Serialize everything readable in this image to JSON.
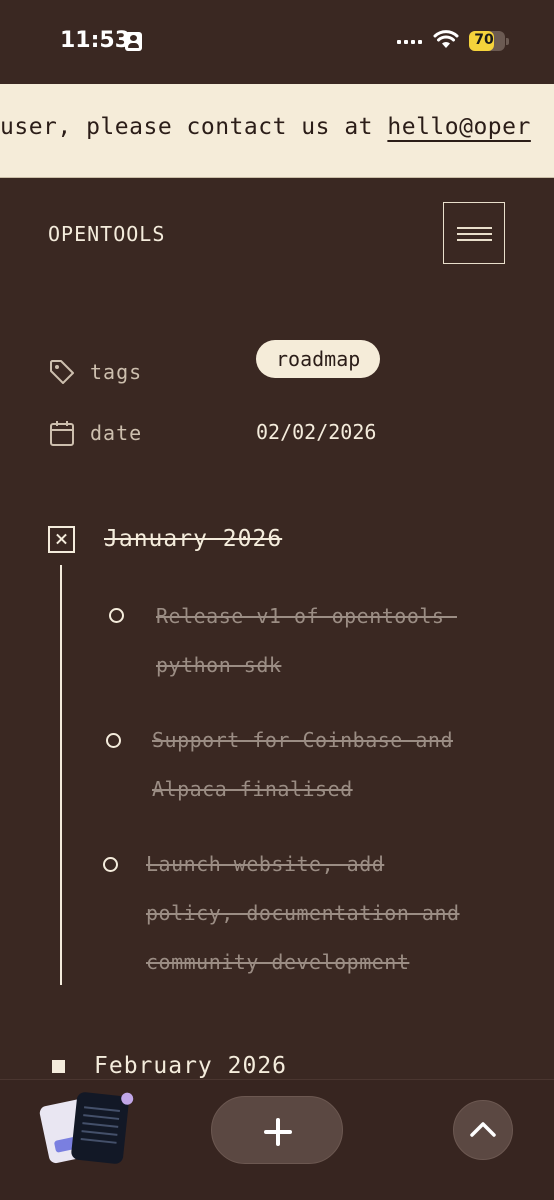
{
  "status_bar": {
    "time": "11:53",
    "battery": "70",
    "battery_level": 0.7,
    "icons": [
      "person-id-icon",
      "signal-dots-icon",
      "wifi-icon",
      "battery-icon"
    ]
  },
  "banner": {
    "text_before": "user, please contact us at ",
    "email": "hello@oper"
  },
  "header": {
    "logo": "OPENTOOLS",
    "menu_icon": "hamburger-menu-icon"
  },
  "meta": {
    "tags_label": "tags",
    "tag": "roadmap",
    "date_label": "date",
    "date": "02/02/2026"
  },
  "roadmap": {
    "month1": {
      "title": "January 2026",
      "items": [
        [
          "Release v1 of opentools-",
          "python-sdk"
        ],
        [
          "Support for Coinbase and",
          "Alpaca finalised"
        ],
        [
          "Launch website, add",
          "policy, documentation and",
          "community development"
        ]
      ]
    },
    "month2": {
      "title": "February 2026"
    }
  },
  "bottom_bar": {
    "tabs_icon": "tab-switcher-icon",
    "new_tab_icon": "plus-icon",
    "scroll_up_icon": "chevron-up-icon"
  },
  "colors": {
    "background": "#3a2822",
    "cream": "#f5ecd9",
    "muted_text": "#9b8d84",
    "battery": "#f5d33b"
  }
}
